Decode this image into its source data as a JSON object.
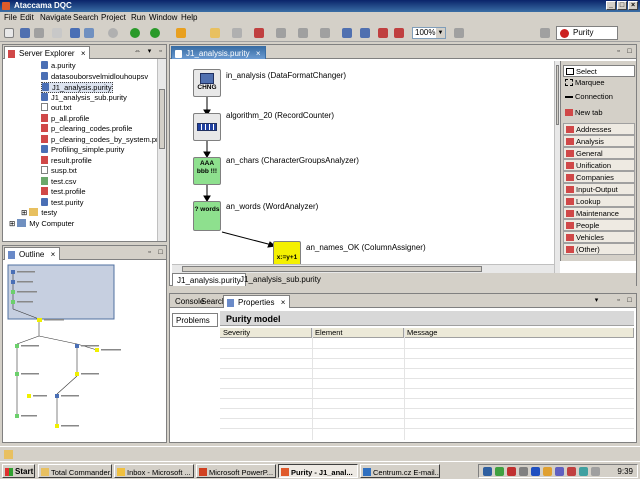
{
  "window": {
    "title": "Ataccama DQC"
  },
  "menu": [
    "File",
    "Edit",
    "Navigate",
    "Search",
    "Project",
    "Run",
    "Window",
    "Help"
  ],
  "toolbar": {
    "zoom": "100%",
    "perspective": "Purity"
  },
  "server_explorer": {
    "title": "Server Explorer",
    "items": [
      {
        "label": "a.purity",
        "icon": "purity"
      },
      {
        "label": "datasouborsvelmidlouhoupsv",
        "icon": "purity"
      },
      {
        "label": "J1_analysis.purity",
        "icon": "purity",
        "selected": true
      },
      {
        "label": "J1_analysis_sub.purity",
        "icon": "purity"
      },
      {
        "label": "out.txt",
        "icon": "txt"
      },
      {
        "label": "p_all.profile",
        "icon": "profile"
      },
      {
        "label": "p_clearing_codes.profile",
        "icon": "profile"
      },
      {
        "label": "p_clearing_codes_by_system.pro",
        "icon": "profile"
      },
      {
        "label": "Profiling_simple.purity",
        "icon": "purity"
      },
      {
        "label": "result.profile",
        "icon": "profile"
      },
      {
        "label": "susp.txt",
        "icon": "txt"
      },
      {
        "label": "test.csv",
        "icon": "csv"
      },
      {
        "label": "test.profile",
        "icon": "profile"
      },
      {
        "label": "test.purity",
        "icon": "purity"
      },
      {
        "label": "testy",
        "icon": "folder"
      },
      {
        "label": "My Computer",
        "icon": "pc"
      }
    ]
  },
  "outline": {
    "title": "Outline"
  },
  "editor": {
    "tab": "J1_analysis.purity",
    "nodes": [
      {
        "icon_text": "CHNG",
        "label": "in_analysis (DataFormatChanger)"
      },
      {
        "icon_text": "",
        "label": "algorithm_20 (RecordCounter)"
      },
      {
        "icon_text": "AAA bbb !!!",
        "label": "an_chars (CharacterGroupsAnalyzer)"
      },
      {
        "icon_text": "? words",
        "label": "an_words (WordAnalyzer)"
      },
      {
        "icon_text": "x:=y+1",
        "label": "an_names_OK (ColumnAssigner)"
      }
    ],
    "bottom_tabs": [
      "J1_analysis.purity",
      "J1_analysis_sub.purity"
    ]
  },
  "palette": {
    "tools": [
      "Select",
      "Marquee",
      "Connection",
      "New tab"
    ],
    "categories": [
      "Addresses",
      "Analysis",
      "General",
      "Unification",
      "Companies",
      "Input-Output",
      "Lookup",
      "Maintenance",
      "People",
      "Vehicles",
      "(Other)"
    ]
  },
  "properties": {
    "tabs": [
      "Console",
      "Search",
      "Properties"
    ],
    "subtab": "Problems",
    "title": "Purity model",
    "columns": [
      "Severity",
      "Element",
      "Message"
    ]
  },
  "taskbar": {
    "start": "Start",
    "tasks": [
      "Total Commander...",
      "Inbox - Microsoft ...",
      "Microsoft PowerP...",
      "Purity - J1_anal...",
      "Centrum.cz E-mail..."
    ],
    "clock": "9:39"
  }
}
